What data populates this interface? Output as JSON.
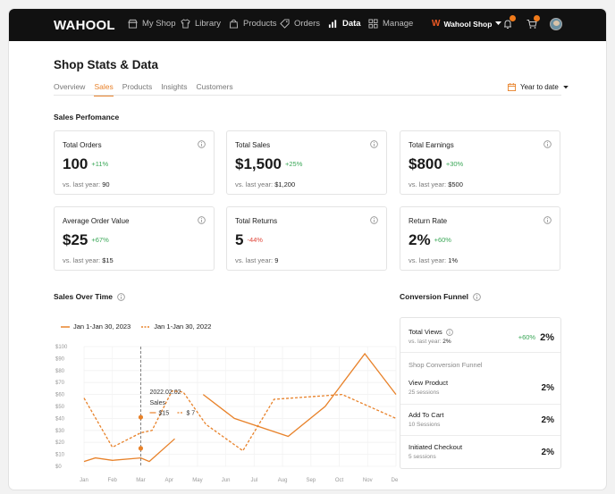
{
  "app": {
    "logo": "WAHOOL",
    "nav": [
      {
        "label": "My Shop",
        "icon": "store-icon"
      },
      {
        "label": "Library",
        "icon": "shirt-icon"
      },
      {
        "label": "Products",
        "icon": "bag-icon"
      },
      {
        "label": "Orders",
        "icon": "tag-icon"
      },
      {
        "label": "Data",
        "icon": "bar-chart-icon",
        "active": true
      },
      {
        "label": "Manage",
        "icon": "grid-icon"
      }
    ],
    "shop_selector": "Wahool Shop",
    "accent": "#e8822a"
  },
  "page": {
    "title": "Shop Stats & Data",
    "tabs": [
      "Overview",
      "Sales",
      "Products",
      "Insights",
      "Customers"
    ],
    "active_tab": "Sales",
    "date_range": "Year to date"
  },
  "sales_performance": {
    "title": "Sales Perfomance",
    "cards": [
      {
        "label": "Total Orders",
        "value": "100",
        "change": "+11%",
        "cmp_label": "vs. last year:",
        "cmp_value": "90"
      },
      {
        "label": "Total Sales",
        "value": "$1,500",
        "change": "+25%",
        "cmp_label": "vs. last year:",
        "cmp_value": "$1,200"
      },
      {
        "label": "Total Earnings",
        "value": "$800",
        "change": "+30%",
        "cmp_label": "vs. last year:",
        "cmp_value": "$500"
      },
      {
        "label": "Average Order Value",
        "value": "$25",
        "change": "+67%",
        "cmp_label": "vs. last year:",
        "cmp_value": "$15"
      },
      {
        "label": "Total Returns",
        "value": "5",
        "change": "-44%",
        "cmp_label": "vs. last year:",
        "cmp_value": "9"
      },
      {
        "label": "Return Rate",
        "value": "2%",
        "change": "+60%",
        "cmp_label": "vs. last year:",
        "cmp_value": "1%"
      }
    ]
  },
  "sales_over_time": {
    "title": "Sales Over Time",
    "tooltip": {
      "date": "2022.02.02",
      "label": "Sales",
      "current": "$15",
      "previous": "$ 7"
    }
  },
  "chart_data": {
    "type": "line",
    "x": [
      "Jan",
      "Feb",
      "Mar",
      "Apr",
      "May",
      "Jun",
      "Jul",
      "Aug",
      "Sep",
      "Oct",
      "Nov",
      "Dec"
    ],
    "ylim": [
      0,
      100
    ],
    "yticks": [
      "$0",
      "$10",
      "$20",
      "$30",
      "$40",
      "$50",
      "$60",
      "$70",
      "$80",
      "$90",
      "$100"
    ],
    "series": [
      {
        "name": "Jan 1-Jan 30, 2023",
        "style": "solid",
        "color": "#e8822a",
        "points": [
          [
            0,
            4
          ],
          [
            0.4,
            7
          ],
          [
            1,
            5
          ],
          [
            2,
            7
          ],
          [
            2.3,
            4
          ],
          [
            3.2,
            23
          ],
          null,
          [
            4.2,
            60
          ],
          [
            5.3,
            40
          ],
          [
            7.2,
            25
          ],
          [
            8.5,
            50
          ],
          [
            9.9,
            94
          ],
          [
            11,
            60
          ]
        ]
      },
      {
        "name": "Jan 1-Jan 30, 2022",
        "style": "dashed",
        "color": "#e8822a",
        "points": [
          [
            0,
            57
          ],
          [
            1,
            16
          ],
          [
            2,
            28
          ],
          [
            2.4,
            30
          ],
          [
            3.1,
            63
          ],
          [
            3.5,
            62
          ],
          [
            4.3,
            35
          ],
          [
            5.6,
            13
          ],
          [
            6.7,
            56
          ],
          [
            9.1,
            60
          ],
          [
            11,
            40
          ]
        ]
      }
    ],
    "cursor": {
      "x": 2,
      "points": [
        {
          "series": 0,
          "y": 15
        },
        {
          "series": 1,
          "y": 7
        }
      ]
    }
  },
  "conversion_funnel": {
    "title": "Conversion Funnel",
    "total_views": {
      "label": "Total Views",
      "change": "+60%",
      "value": "2%",
      "cmp_label": "vs. last year:",
      "cmp_value": "2%"
    },
    "subtitle": "Shop Conversion Funnel",
    "steps": [
      {
        "label": "View Product",
        "sessions": "25 sessions",
        "value": "2%"
      },
      {
        "label": "Add To Cart",
        "sessions": "10 Sessions",
        "value": "2%"
      },
      {
        "label": "Initiated Checkout",
        "sessions": "5 sessions",
        "value": "2%"
      }
    ]
  }
}
